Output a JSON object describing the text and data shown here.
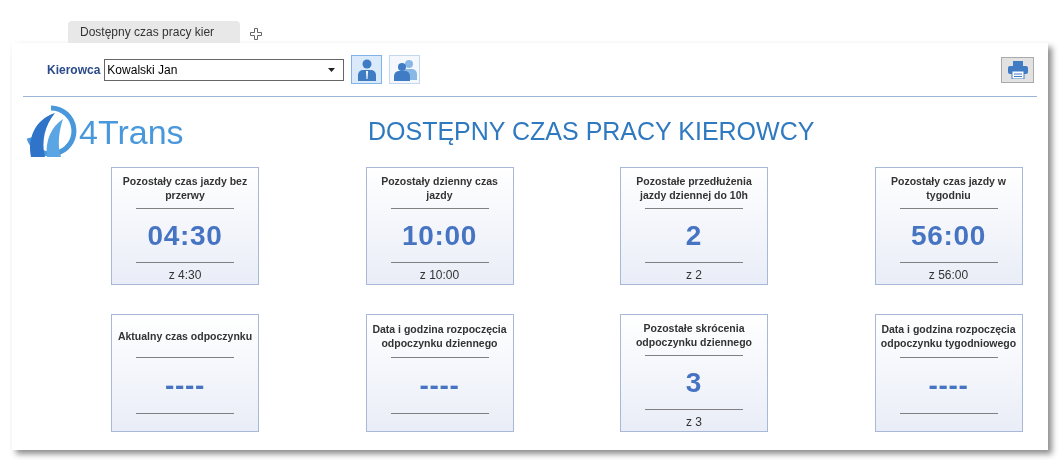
{
  "tab": {
    "label": "Dostępny czas pracy kier"
  },
  "driver": {
    "label": "Kierowca",
    "value": "Kowalski Jan"
  },
  "driver_buttons": [
    {
      "kind": "single",
      "selected": true
    },
    {
      "kind": "group",
      "selected": false
    }
  ],
  "logo": {
    "text": "4Trans"
  },
  "title": "DOSTĘPNY CZAS PRACY KIEROWCY",
  "cards": [
    {
      "title": "Pozostały czas jazdy bez przerwy",
      "value": "04:30",
      "total": "z 4:30"
    },
    {
      "title": "Pozostały dzienny czas jazdy",
      "value": "10:00",
      "total": "z 10:00"
    },
    {
      "title": "Pozostałe przedłużenia jazdy dziennej do 10h",
      "value": "2",
      "total": "z 2"
    },
    {
      "title": "Pozostały czas jazdy w tygodniu",
      "value": "56:00",
      "total": "z 56:00"
    },
    {
      "title": "Aktualny czas odpoczynku",
      "value": "----"
    },
    {
      "title": "Data i godzina rozpoczęcia odpoczynku dziennego",
      "value": "----"
    },
    {
      "title": "Pozostałe skrócenia odpoczynku dziennego",
      "value": "3",
      "total": "z 3"
    },
    {
      "title": "Data i godzina rozpoczęcia odpoczynku tygodniowego",
      "value": "----"
    }
  ]
}
